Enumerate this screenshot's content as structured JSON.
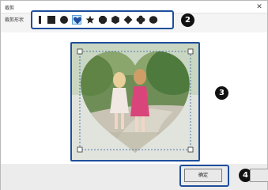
{
  "window": {
    "title": "裁剪",
    "close_icon": "close-icon"
  },
  "toolbar": {
    "shape_label": "裁剪形状",
    "shapes": [
      {
        "name": "narrow-rectangle",
        "selected": false
      },
      {
        "name": "square",
        "selected": false
      },
      {
        "name": "circle",
        "selected": false
      },
      {
        "name": "heart",
        "selected": true
      },
      {
        "name": "star",
        "selected": false
      },
      {
        "name": "octagon",
        "selected": false
      },
      {
        "name": "hexagon",
        "selected": false
      },
      {
        "name": "diamond",
        "selected": false
      },
      {
        "name": "clover",
        "selected": false
      },
      {
        "name": "oval",
        "selected": false
      }
    ]
  },
  "callouts": {
    "c2": "2",
    "c3": "3",
    "c4": "4"
  },
  "footer": {
    "ok_label": "确定"
  },
  "colors": {
    "accent_border": "#1e4f9c",
    "selected_bg": "#cde4f7"
  }
}
